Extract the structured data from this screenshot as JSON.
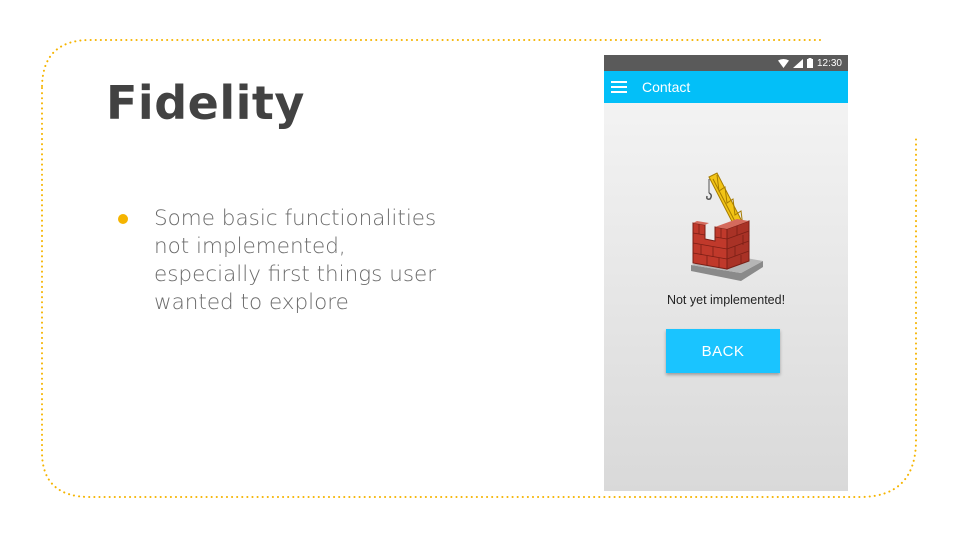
{
  "slide": {
    "title": "Fidelity",
    "bullets": [
      {
        "text": "Some basic functionalities not implemented, especially first things user wanted to explore",
        "marker_color": "#f5b400"
      }
    ],
    "decoration_color": "#f5b400"
  },
  "phone": {
    "status_bar": {
      "time": "12:30",
      "icons": [
        "wifi-icon",
        "signal-icon",
        "battery-icon"
      ]
    },
    "app_bar": {
      "menu_icon": "hamburger-menu-icon",
      "title": "Contact",
      "color": "#03bff8"
    },
    "content": {
      "illustration": "under-construction-crane-icon",
      "message": "Not yet implemented!",
      "back_button_label": "BACK",
      "button_color": "#1ac4ff"
    }
  }
}
